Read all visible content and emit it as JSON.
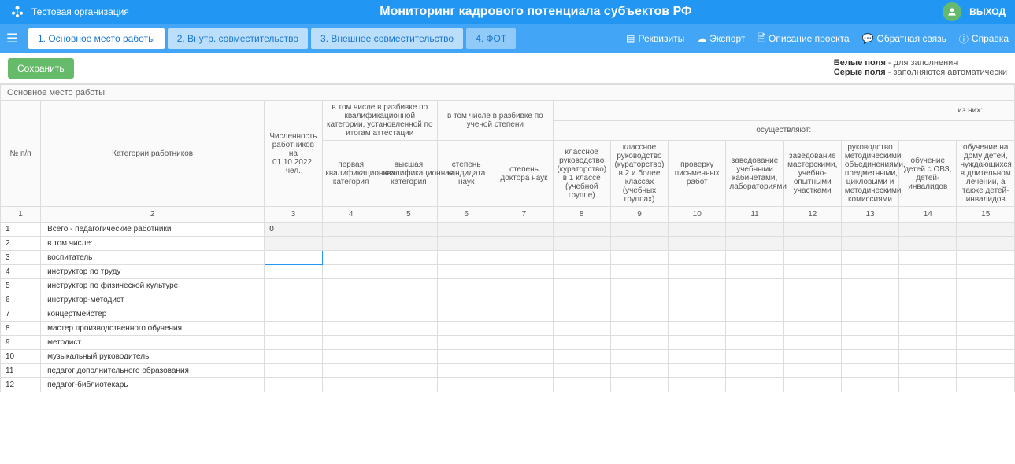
{
  "header": {
    "org": "Тестовая организация",
    "title": "Мониторинг кадрового потенциала субъектов РФ",
    "exit": "ВЫХОД"
  },
  "tabs": [
    "1. Основное место работы",
    "2. Внутр. совместительство",
    "3. Внешнее совместительство",
    "4. ФОТ"
  ],
  "links": {
    "requisites": "Реквизиты",
    "export": "Экспорт",
    "desc": "Описание проекта",
    "feedback": "Обратная связь",
    "help": "Справка"
  },
  "save": "Сохранить",
  "legend": {
    "white_b": "Белые поля",
    "white_t": " - для заполнения",
    "grey_b": "Серые поля",
    "grey_t": " - заполняются автоматически"
  },
  "section": "Основное место работы",
  "group1": "в том числе в разбивке по квалификационной категории, установленной по итогам аттестации",
  "group2": "в том числе в разбивке по ученой степени",
  "group3": "осуществляют:",
  "group3_sub": "из них:",
  "cols": {
    "npp": "№ п/п",
    "cat": "Категории работников",
    "c3": "Численность работников на 01.10.2022, чел.",
    "c4": "первая квалификационная категория",
    "c5": "высшая квалификационная категория",
    "c6": "степень кандидата наук",
    "c7": "степень доктора наук",
    "c8": "классное руководство (кураторство) в 1 классе (учебной группе)",
    "c9": "классное руководство (кураторство) в 2 и более классах (учебных группах)",
    "c10": "проверку письменных работ",
    "c11": "заведование учебными кабинетами, лабораториями",
    "c12": "заведование мастерскими, учебно-опытными участками",
    "c13": "руководство методическими объединениями, предметными, цикловыми и методическими комиссиями",
    "c14": "обучение детей с ОВЗ, детей-инвалидов",
    "c15": "обучение на дому детей, нуждающихся в длительном лечении, а также детей-инвалидов"
  },
  "colnums": [
    "1",
    "2",
    "3",
    "4",
    "5",
    "6",
    "7",
    "8",
    "9",
    "10",
    "11",
    "12",
    "13",
    "14",
    "15"
  ],
  "rows": [
    {
      "n": "1",
      "cat": "Всего - педагогические работники",
      "v3": "0",
      "grey": true
    },
    {
      "n": "2",
      "cat": "в том числе:",
      "grey": true
    },
    {
      "n": "3",
      "cat": "воспитатель",
      "active": true
    },
    {
      "n": "4",
      "cat": "инструктор по труду"
    },
    {
      "n": "5",
      "cat": "инструктор по физической культуре"
    },
    {
      "n": "6",
      "cat": "инструктор-методист"
    },
    {
      "n": "7",
      "cat": "концертмейстер"
    },
    {
      "n": "8",
      "cat": "мастер производственного обучения"
    },
    {
      "n": "9",
      "cat": "методист"
    },
    {
      "n": "10",
      "cat": "музыкальный руководитель"
    },
    {
      "n": "11",
      "cat": "педагог дополнительного образования"
    },
    {
      "n": "12",
      "cat": "педагог-библиотекарь"
    }
  ]
}
